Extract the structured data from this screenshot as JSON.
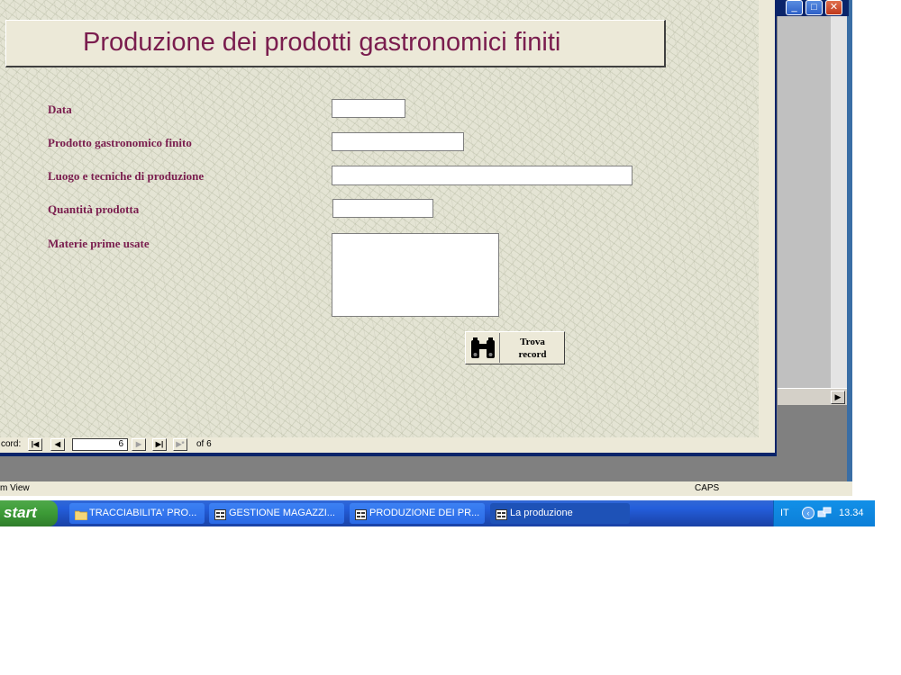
{
  "form": {
    "title": "Produzione dei prodotti gastronomici finiti",
    "fields": [
      {
        "label": "Data",
        "value": ""
      },
      {
        "label": "Prodotto gastronomico finito",
        "value": ""
      },
      {
        "label": "Luogo e tecniche di produzione",
        "value": ""
      },
      {
        "label": "Quantità prodotta",
        "value": ""
      },
      {
        "label": "Materie prime usate",
        "value": ""
      }
    ],
    "find_button": {
      "label_line1": "Trova",
      "label_line2": "record",
      "icon": "binoculars-icon"
    }
  },
  "navigation": {
    "label": "cord:",
    "current_record": "6",
    "of_text": "of  6"
  },
  "statusbar": {
    "left_text": "m View",
    "caps": "CAPS"
  },
  "taskbar": {
    "start_label": "start",
    "items": [
      {
        "label": "TRACCIABILITA' PRO...",
        "icon": "folder-icon",
        "active": false
      },
      {
        "label": "GESTIONE MAGAZZI...",
        "icon": "access-form-icon",
        "active": false
      },
      {
        "label": "PRODUZIONE DEI PR...",
        "icon": "access-form-icon",
        "active": false
      },
      {
        "label": "La produzione",
        "icon": "access-form-icon",
        "active": true
      }
    ],
    "tray": {
      "language": "IT",
      "time": "13.34"
    }
  },
  "colors": {
    "label_color": "#7a1d4e",
    "title_color": "#7a1d4e",
    "taskbar_blue": "#245edb",
    "start_green": "#3c9a36"
  }
}
